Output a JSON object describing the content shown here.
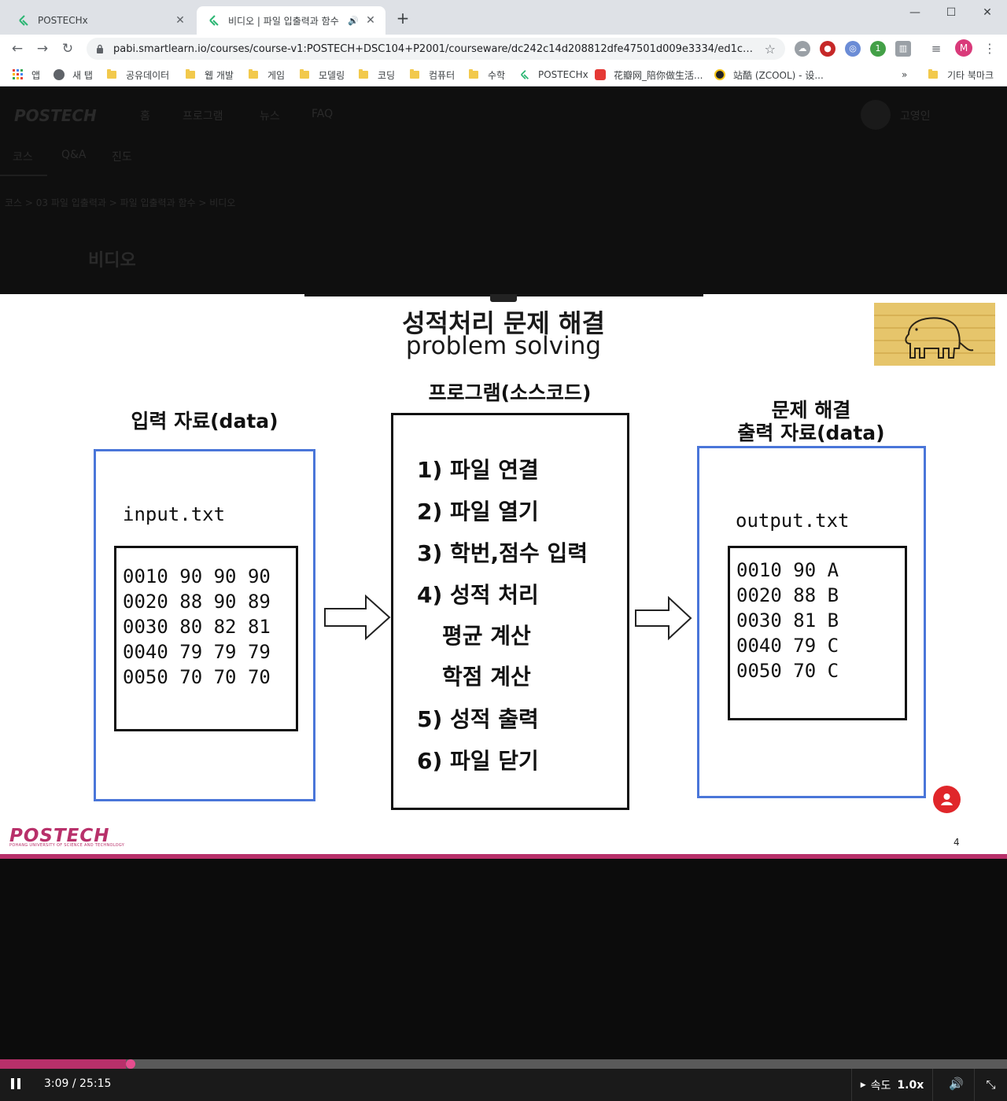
{
  "browser": {
    "tabs": [
      {
        "title": "POSTECHx",
        "active": false
      },
      {
        "title": "비디오 | 파일 입출력과 함수",
        "active": true
      }
    ],
    "url": "pabi.smartlearn.io/courses/course-v1:POSTECH+DSC104+P2001/courseware/dc242c14d208812dfe47501d009e3334/ed1c44fd8a1...",
    "profile_initial": "M",
    "extension_badge": "1",
    "bookmarks": [
      "앱",
      "새 탭",
      "공유데이터",
      "웹 개발",
      "게임",
      "모델링",
      "코딩",
      "컴퓨터",
      "수학",
      "POSTECHx",
      "花瓣网_陪你做生活...",
      "站酷 (ZCOOL) - 设...",
      "기타 북마크"
    ],
    "bookmarks_overflow": "»"
  },
  "page": {
    "nav": [
      "홈",
      "프로그램",
      "뉴스",
      "FAQ"
    ],
    "user_name": "고영인",
    "subnav": [
      "코스",
      "Q&A",
      "진도"
    ],
    "breadcrumb": "코스 > 03 파일 입출력과 > 파일 입출력과 함수 > 비디오",
    "heading": "비디오"
  },
  "slide": {
    "title_ko": "성적처리 문제 해결",
    "title_en": "problem solving",
    "input_label": "입력 자료(data)",
    "input_file": "input.txt",
    "input_rows": [
      "0010 90 90 90",
      "0020 88 90 89",
      "0030 80 82 81",
      "0040 79 79 79",
      "0050 70 70 70"
    ],
    "program_label": "프로그램(소스코드)",
    "steps": [
      "1) 파일 연결",
      "2) 파일 열기",
      "3) 학번,점수 입력",
      "4) 성적 처리",
      "평균 계산",
      "학점 계산",
      "5) 성적 출력",
      "6) 파일 닫기"
    ],
    "output_label_1": "문제 해결",
    "output_label_2": "출력 자료(data)",
    "output_file": "output.txt",
    "output_rows": [
      "0010 90 A",
      "0020 88 B",
      "0030 81 B",
      "0040 79 C",
      "0050 70 C"
    ],
    "logo": "POSTECH",
    "logo_sub": "POHANG UNIVERSITY OF SCIENCE AND TECHNOLOGY",
    "page_number": "4"
  },
  "player": {
    "time": "3:09 / 25:15",
    "progress_fraction": 0.125,
    "speed_label": "속도",
    "speed_value": "1.0x"
  },
  "colors": {
    "accent": "#b8306a",
    "slide_blue": "#4a76d9"
  }
}
